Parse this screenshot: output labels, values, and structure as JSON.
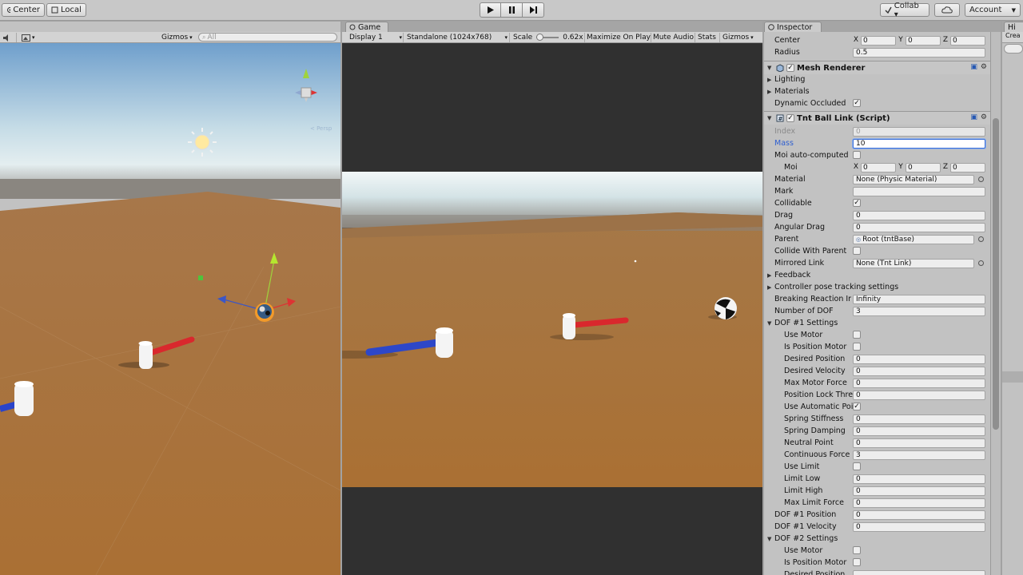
{
  "toolbar": {
    "pivot_label": "Center",
    "space_label": "Local",
    "collab_label": "Collab ▾",
    "account_label": "Account"
  },
  "scene": {
    "gizmos_label": "Gizmos",
    "search_placeholder": "All",
    "persp_label": "< Persp"
  },
  "game": {
    "tab_label": "Game",
    "display_label": "Display 1",
    "resolution_label": "Standalone (1024x768)",
    "scale_label": "Scale",
    "scale_value": "0.62x",
    "maximize_label": "Maximize On Play",
    "mute_label": "Mute Audio",
    "stats_label": "Stats",
    "gizmos_label": "Gizmos"
  },
  "inspector": {
    "tab_label": "Inspector",
    "collider": {
      "center_label": "Center",
      "center": {
        "x": "0",
        "y": "0",
        "z": "0"
      },
      "radius_label": "Radius",
      "radius": "0.5"
    },
    "mesh_renderer": {
      "title": "Mesh Renderer",
      "lighting_label": "Lighting",
      "materials_label": "Materials",
      "dynamic_occluded_label": "Dynamic Occluded"
    },
    "script": {
      "title": "Tnt Ball Link (Script)",
      "rows": [
        {
          "label": "Index",
          "value": "0"
        },
        {
          "label": "Mass",
          "value": "10"
        },
        {
          "label": "Moi auto-computed"
        },
        {
          "label": "Moi"
        },
        {
          "label": "Material",
          "value": "None (Physic Material)"
        },
        {
          "label": "Mark",
          "value": ""
        },
        {
          "label": "Collidable"
        },
        {
          "label": "Drag",
          "value": "0"
        },
        {
          "label": "Angular Drag",
          "value": "0"
        },
        {
          "label": "Parent",
          "value": "Root (tntBase)"
        },
        {
          "label": "Collide With Parent"
        },
        {
          "label": "Mirrored Link",
          "value": "None (Tnt Link)"
        },
        {
          "label": "Feedback"
        },
        {
          "label": "Controller pose tracking settings"
        },
        {
          "label": "Breaking Reaction Ir",
          "value": "Infinity"
        },
        {
          "label": "Number of DOF",
          "value": "3"
        },
        {
          "label": "DOF #1 Settings"
        },
        {
          "label": "Use Motor"
        },
        {
          "label": "Is Position Motor"
        },
        {
          "label": "Desired Position",
          "value": "0"
        },
        {
          "label": "Desired Velocity",
          "value": "0"
        },
        {
          "label": "Max Motor Force",
          "value": "0"
        },
        {
          "label": "Position Lock Thre",
          "value": "0"
        },
        {
          "label": "Use Automatic Poi"
        },
        {
          "label": "Spring Stiffness",
          "value": "0"
        },
        {
          "label": "Spring Damping",
          "value": "0"
        },
        {
          "label": "Neutral Point",
          "value": "0"
        },
        {
          "label": "Continuous Force",
          "value": "3"
        },
        {
          "label": "Use Limit"
        },
        {
          "label": "Limit Low",
          "value": "0"
        },
        {
          "label": "Limit High",
          "value": "0"
        },
        {
          "label": "Max Limit Force",
          "value": "0"
        },
        {
          "label": "DOF #1 Position",
          "value": "0"
        },
        {
          "label": "DOF #1 Velocity",
          "value": "0"
        },
        {
          "label": "DOF #2 Settings"
        },
        {
          "label": "Use Motor"
        },
        {
          "label": "Is Position Motor"
        },
        {
          "label": "Desired Position"
        }
      ],
      "moi": {
        "x": "0",
        "y": "0",
        "z": "0"
      }
    }
  },
  "hierarchy": {
    "tab_label": "Hi",
    "create_label": "Crea"
  }
}
